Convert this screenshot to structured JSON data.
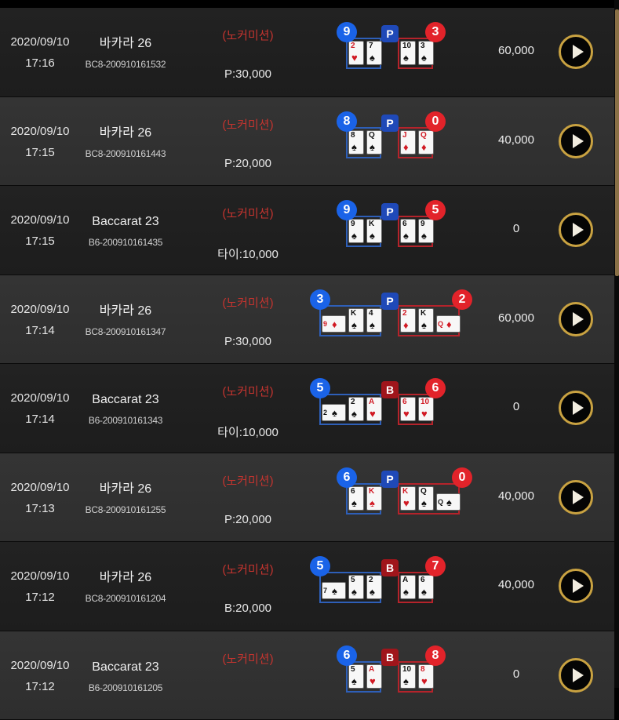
{
  "rows": [
    {
      "date": "2020/09/10",
      "time": "17:16",
      "game": "바카라 26",
      "code": "BC8-200910161532",
      "mode": "(노커미션)",
      "bet": "P:30,000",
      "amount": "60,000",
      "player": {
        "score": "9",
        "cards": [
          {
            "r": "2",
            "s": "♥",
            "red": true
          },
          {
            "r": "7",
            "s": "♠",
            "red": false
          }
        ]
      },
      "winner": "P",
      "banker": {
        "score": "3",
        "cards": [
          {
            "r": "10",
            "s": "♠",
            "red": false
          },
          {
            "r": "3",
            "s": "♠",
            "red": false
          }
        ]
      }
    },
    {
      "date": "2020/09/10",
      "time": "17:15",
      "game": "바카라 26",
      "code": "BC8-200910161443",
      "mode": "(노커미션)",
      "bet": "P:20,000",
      "amount": "40,000",
      "player": {
        "score": "8",
        "cards": [
          {
            "r": "8",
            "s": "♠",
            "red": false
          },
          {
            "r": "Q",
            "s": "♠",
            "red": false
          }
        ]
      },
      "winner": "P",
      "banker": {
        "score": "0",
        "cards": [
          {
            "r": "J",
            "s": "♦",
            "red": true
          },
          {
            "r": "Q",
            "s": "♦",
            "red": true
          }
        ]
      }
    },
    {
      "date": "2020/09/10",
      "time": "17:15",
      "game": "Baccarat 23",
      "code": "B6-200910161435",
      "mode": "(노커미션)",
      "bet": "타이:10,000",
      "amount": "0",
      "player": {
        "score": "9",
        "cards": [
          {
            "r": "9",
            "s": "♠",
            "red": false
          },
          {
            "r": "K",
            "s": "♠",
            "red": false
          }
        ]
      },
      "winner": "P",
      "banker": {
        "score": "5",
        "cards": [
          {
            "r": "6",
            "s": "♠",
            "red": false
          },
          {
            "r": "9",
            "s": "♠",
            "red": false
          }
        ]
      }
    },
    {
      "date": "2020/09/10",
      "time": "17:14",
      "game": "바카라 26",
      "code": "BC8-200910161347",
      "mode": "(노커미션)",
      "bet": "P:30,000",
      "amount": "60,000",
      "player": {
        "score": "3",
        "third": {
          "r": "9",
          "s": "♦",
          "red": true
        },
        "cards": [
          {
            "r": "K",
            "s": "♠",
            "red": false
          },
          {
            "r": "4",
            "s": "♠",
            "red": false
          }
        ]
      },
      "winner": "P",
      "banker": {
        "score": "2",
        "third": {
          "r": "Q",
          "s": "♦",
          "red": true
        },
        "cards": [
          {
            "r": "2",
            "s": "♦",
            "red": true
          },
          {
            "r": "K",
            "s": "♠",
            "red": false
          }
        ]
      }
    },
    {
      "date": "2020/09/10",
      "time": "17:14",
      "game": "Baccarat 23",
      "code": "B6-200910161343",
      "mode": "(노커미션)",
      "bet": "타이:10,000",
      "amount": "0",
      "player": {
        "score": "5",
        "third": {
          "r": "2",
          "s": "♠",
          "red": false
        },
        "cards": [
          {
            "r": "2",
            "s": "♠",
            "red": false
          },
          {
            "r": "A",
            "s": "♥",
            "red": true
          }
        ]
      },
      "winner": "B",
      "banker": {
        "score": "6",
        "cards": [
          {
            "r": "6",
            "s": "♥",
            "red": true
          },
          {
            "r": "10",
            "s": "♥",
            "red": true
          }
        ]
      }
    },
    {
      "date": "2020/09/10",
      "time": "17:13",
      "game": "바카라 26",
      "code": "BC8-200910161255",
      "mode": "(노커미션)",
      "bet": "P:20,000",
      "amount": "40,000",
      "player": {
        "score": "6",
        "cards": [
          {
            "r": "6",
            "s": "♠",
            "red": false
          },
          {
            "r": "K",
            "s": "♠",
            "red": true
          }
        ]
      },
      "winner": "P",
      "banker": {
        "score": "0",
        "third": {
          "r": "Q",
          "s": "♠",
          "red": false
        },
        "cards": [
          {
            "r": "K",
            "s": "♥",
            "red": true
          },
          {
            "r": "Q",
            "s": "♠",
            "red": false
          }
        ]
      }
    },
    {
      "date": "2020/09/10",
      "time": "17:12",
      "game": "바카라 26",
      "code": "BC8-200910161204",
      "mode": "(노커미션)",
      "bet": "B:20,000",
      "amount": "40,000",
      "player": {
        "score": "5",
        "third": {
          "r": "7",
          "s": "♠",
          "red": false
        },
        "cards": [
          {
            "r": "5",
            "s": "♠",
            "red": false
          },
          {
            "r": "2",
            "s": "♠",
            "red": false
          }
        ]
      },
      "winner": "B",
      "banker": {
        "score": "7",
        "cards": [
          {
            "r": "A",
            "s": "♠",
            "red": false
          },
          {
            "r": "6",
            "s": "♠",
            "red": false
          }
        ]
      }
    },
    {
      "date": "2020/09/10",
      "time": "17:12",
      "game": "Baccarat 23",
      "code": "B6-200910161205",
      "mode": "(노커미션)",
      "bet": "",
      "amount": "0",
      "player": {
        "score": "6",
        "cards": [
          {
            "r": "5",
            "s": "♠",
            "red": false
          },
          {
            "r": "A",
            "s": "♥",
            "red": true
          }
        ]
      },
      "winner": "B",
      "banker": {
        "score": "8",
        "cards": [
          {
            "r": "10",
            "s": "♠",
            "red": false
          },
          {
            "r": "8",
            "s": "♥",
            "red": true
          }
        ]
      }
    }
  ]
}
